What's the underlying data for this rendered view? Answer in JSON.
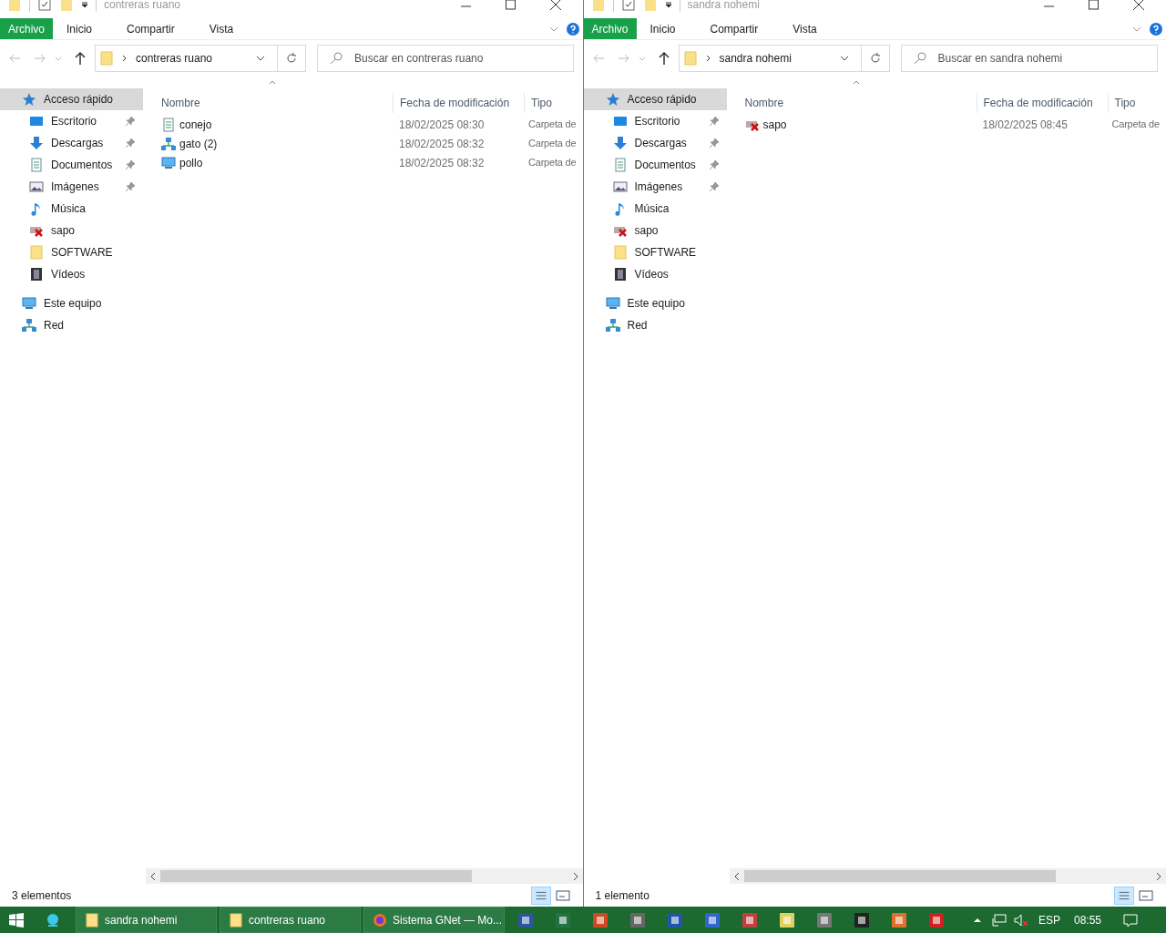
{
  "windows": [
    {
      "title": "contreras ruano",
      "ribbon_tabs": [
        {
          "label": "Archivo",
          "selected": true
        },
        {
          "label": "Inicio",
          "selected": false
        },
        {
          "label": "Compartir",
          "selected": false
        },
        {
          "label": "Vista",
          "selected": false
        }
      ],
      "address": "contreras ruano",
      "search_placeholder": "Buscar en contreras ruano",
      "nav": [
        {
          "label": "Acceso rápido",
          "kind": "star",
          "selected": true,
          "children": [
            {
              "label": "Escritorio",
              "kind": "desktop",
              "pinned": true,
              "selected": false
            },
            {
              "label": "Descargas",
              "kind": "download",
              "pinned": true,
              "selected": false
            },
            {
              "label": "Documentos",
              "kind": "document",
              "pinned": true,
              "selected": false
            },
            {
              "label": "Imágenes",
              "kind": "pictures",
              "pinned": true,
              "selected": false
            },
            {
              "label": "Música",
              "kind": "music",
              "pinned": false,
              "selected": false
            },
            {
              "label": "sapo",
              "kind": "broken",
              "pinned": false,
              "selected": false
            },
            {
              "label": "SOFTWARE",
              "kind": "folder",
              "pinned": false,
              "selected": false
            },
            {
              "label": "Vídeos",
              "kind": "video",
              "pinned": false,
              "selected": false
            }
          ]
        },
        {
          "label": "Este equipo",
          "kind": "pc",
          "selected": false
        },
        {
          "label": "Red",
          "kind": "network",
          "selected": false
        }
      ],
      "columns": [
        "Nombre",
        "Fecha de modificación",
        "Tipo"
      ],
      "rows": [
        {
          "name": "conejo",
          "kind": "document",
          "date": "18/02/2025 08:30",
          "type": "Carpeta de"
        },
        {
          "name": "gato (2)",
          "kind": "network",
          "date": "18/02/2025 08:32",
          "type": "Carpeta de"
        },
        {
          "name": "pollo",
          "kind": "pc",
          "date": "18/02/2025 08:32",
          "type": "Carpeta de"
        }
      ],
      "status": "3 elementos"
    },
    {
      "title": "sandra nohemi",
      "ribbon_tabs": [
        {
          "label": "Archivo",
          "selected": true
        },
        {
          "label": "Inicio",
          "selected": false
        },
        {
          "label": "Compartir",
          "selected": false
        },
        {
          "label": "Vista",
          "selected": false
        }
      ],
      "address": "sandra nohemi",
      "search_placeholder": "Buscar en sandra nohemi",
      "nav": [
        {
          "label": "Acceso rápido",
          "kind": "star",
          "selected": true,
          "children": [
            {
              "label": "Escritorio",
              "kind": "desktop",
              "pinned": true,
              "selected": false
            },
            {
              "label": "Descargas",
              "kind": "download",
              "pinned": true,
              "selected": false
            },
            {
              "label": "Documentos",
              "kind": "document",
              "pinned": true,
              "selected": false
            },
            {
              "label": "Imágenes",
              "kind": "pictures",
              "pinned": true,
              "selected": false
            },
            {
              "label": "Música",
              "kind": "music",
              "pinned": false,
              "selected": false
            },
            {
              "label": "sapo",
              "kind": "broken",
              "pinned": false,
              "selected": false
            },
            {
              "label": "SOFTWARE",
              "kind": "folder",
              "pinned": false,
              "selected": false
            },
            {
              "label": "Vídeos",
              "kind": "video",
              "pinned": false,
              "selected": false
            }
          ]
        },
        {
          "label": "Este equipo",
          "kind": "pc",
          "selected": false
        },
        {
          "label": "Red",
          "kind": "network",
          "selected": false
        }
      ],
      "columns": [
        "Nombre",
        "Fecha de modificación",
        "Tipo"
      ],
      "rows": [
        {
          "name": "sapo",
          "kind": "broken",
          "date": "18/02/2025 08:45",
          "type": "Carpeta de"
        }
      ],
      "status": "1 elemento"
    }
  ],
  "taskbar": {
    "windows": [
      {
        "label": "sandra nohemi",
        "kind": "folder"
      },
      {
        "label": "contreras ruano",
        "kind": "folder"
      },
      {
        "label": "Sistema GNet — Mo...",
        "kind": "browser"
      }
    ],
    "language": "ESP",
    "time": "08:55"
  }
}
